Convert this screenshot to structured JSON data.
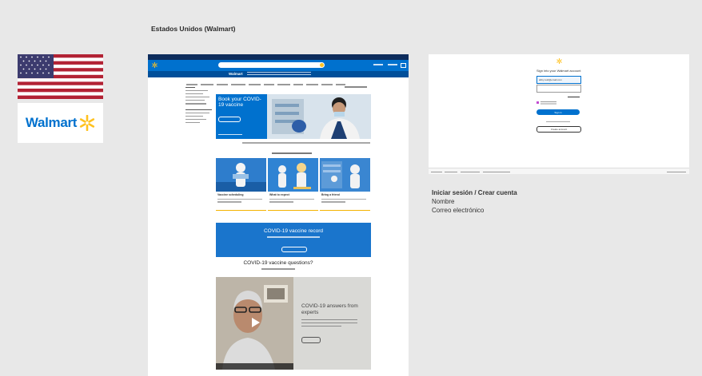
{
  "board": {
    "title": "Estados Unidos (Walmart)"
  },
  "brand": {
    "logo_text": "Walmart",
    "blue": "#0071ce",
    "yellow": "#ffc220",
    "navy": "#0d2c5c"
  },
  "flag": {
    "icon": "us-flag",
    "red": "#b22234",
    "blue": "#3c3b6e"
  },
  "walmart_page": {
    "hero": {
      "title": "Book your COVID-19 vaccine"
    },
    "cards": [
      {
        "title": "Vaccine scheduling"
      },
      {
        "title": "What to expect"
      },
      {
        "title": "Bring a friend"
      }
    ],
    "record": {
      "title": "COVID-19 vaccine record"
    },
    "questions": {
      "title": "COVID-19 vaccine questions?"
    },
    "video": {
      "title": "COVID-19 answers from experts"
    }
  },
  "signin_page": {
    "title": "Sign into your Walmart account",
    "email_value": "abby.reid@email.com",
    "button_label": "Sign in",
    "create_label": "Create account"
  },
  "signin_caption": {
    "heading": "Iniciar sesión / Crear cuenta",
    "line1": "Nombre",
    "line2": "Correo electrónico"
  }
}
